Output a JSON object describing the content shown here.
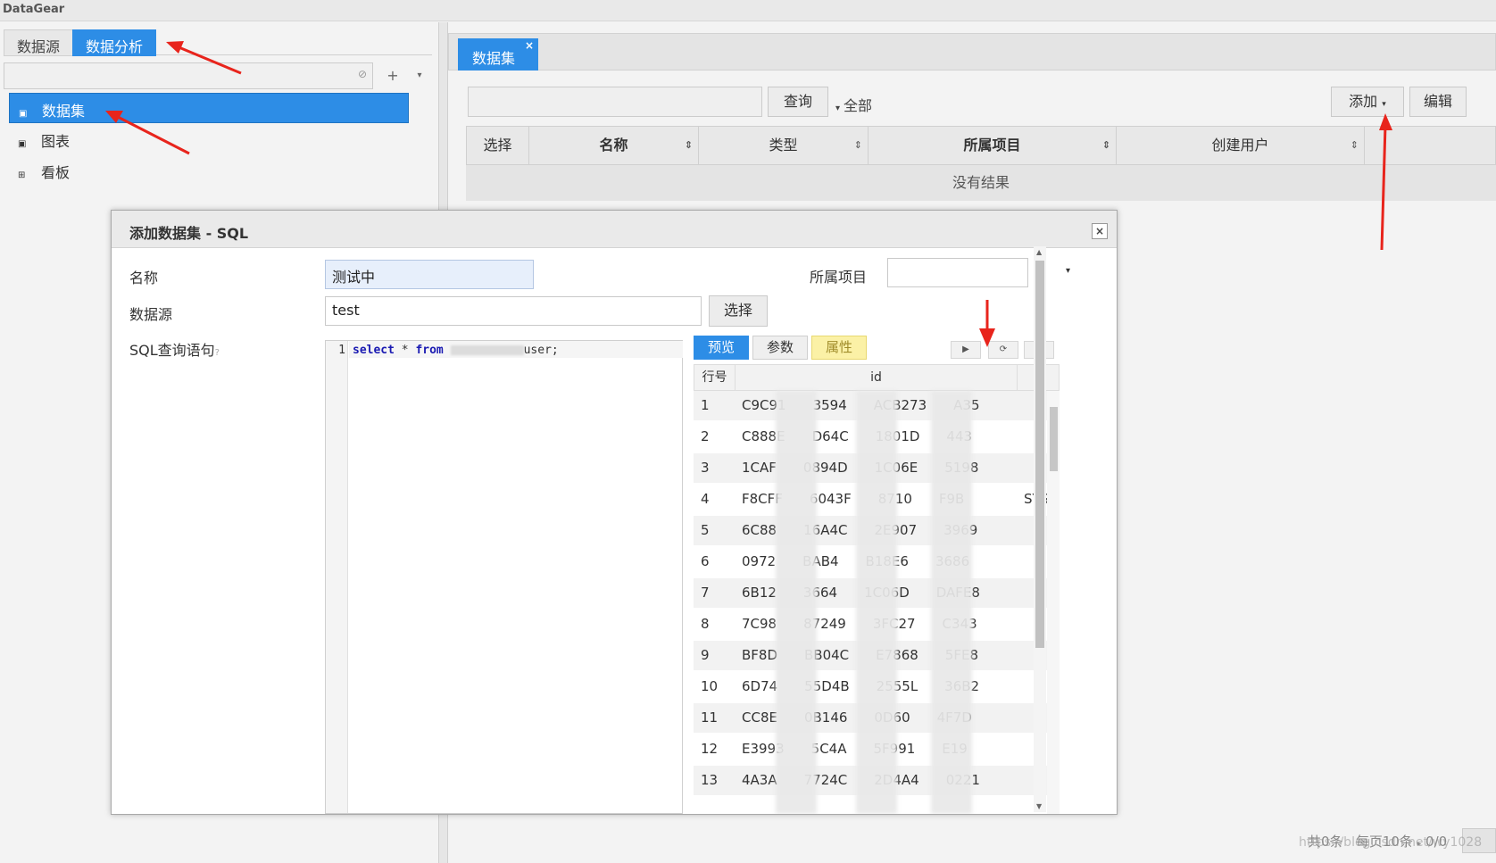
{
  "app": {
    "title": "DataGear"
  },
  "left": {
    "tabs": [
      {
        "label": "数据源",
        "active": false
      },
      {
        "label": "数据分析",
        "active": true
      }
    ],
    "tree": [
      {
        "label": "数据集",
        "icon": "dataset-icon",
        "active": true
      },
      {
        "label": "图表",
        "icon": "chart-icon",
        "active": false
      },
      {
        "label": "看板",
        "icon": "dashboard-icon",
        "active": false
      }
    ],
    "add_button": "+",
    "more_button": "▾"
  },
  "right": {
    "tab": {
      "label": "数据集",
      "close": "×"
    },
    "search_placeholder": "",
    "query_button": "查询",
    "filter_label": "全部",
    "add_button": "添加",
    "edit_button": "编辑",
    "columns": [
      {
        "label": "选择",
        "sortable": false
      },
      {
        "label": "名称",
        "sortable": true
      },
      {
        "label": "类型",
        "sortable": true
      },
      {
        "label": "所属项目",
        "sortable": true
      },
      {
        "label": "创建用户",
        "sortable": true
      }
    ],
    "empty_text": "没有结果",
    "pager": {
      "total": "共0条",
      "per_page": "每页10条",
      "page": "0/0"
    }
  },
  "dialog": {
    "title": "添加数据集 - SQL",
    "close": "×",
    "name_label": "名称",
    "name_value": "测试中",
    "project_label": "所属项目",
    "project_value": "",
    "datasource_label": "数据源",
    "datasource_value": "test",
    "select_button": "选择",
    "sql_label": "SQL查询语句",
    "sql_help": "?",
    "sql": {
      "line": "1",
      "kw1": "select",
      "star": " * ",
      "kw2": "from",
      "table_suffix": "user;"
    },
    "preview_tabs": [
      {
        "label": "预览",
        "state": "active"
      },
      {
        "label": "参数",
        "state": "normal"
      },
      {
        "label": "属性",
        "state": "highlight"
      }
    ],
    "tool_buttons": [
      {
        "icon": "run-icon",
        "glyph": "▶"
      },
      {
        "icon": "refresh-icon",
        "glyph": "⟳"
      },
      {
        "icon": "expand-icon",
        "glyph": "↗"
      }
    ],
    "grid": {
      "head_row": "行号",
      "head_id": "id",
      "rows": [
        {
          "n": "1",
          "id": "C9C91  3594  ACB273  A35",
          "extra": ""
        },
        {
          "n": "2",
          "id": "C888E  D64C  1801D  443",
          "extra": ""
        },
        {
          "n": "3",
          "id": "1CAF  0894D  1C06E  5198",
          "extra": ""
        },
        {
          "n": "4",
          "id": "F8CFF  6043F  8710  F9B",
          "extra": "SYS"
        },
        {
          "n": "5",
          "id": "6C88  16A4C  2E907  3969",
          "extra": ""
        },
        {
          "n": "6",
          "id": "0972  BAB4  B18E6  3686",
          "extra": ""
        },
        {
          "n": "7",
          "id": "6B12  3664  1C06D  DAFE8",
          "extra": ""
        },
        {
          "n": "8",
          "id": "7C98  87249  3FC27  C343",
          "extra": ""
        },
        {
          "n": "9",
          "id": "BF8D  BB04C  E7868  5FE8",
          "extra": ""
        },
        {
          "n": "10",
          "id": "6D74  55D4B  2555L  36B2",
          "extra": ""
        },
        {
          "n": "11",
          "id": "CC8E  0B146  0D60  4F7D",
          "extra": ""
        },
        {
          "n": "12",
          "id": "E3993  5C4A  5F991  E19",
          "extra": ""
        },
        {
          "n": "13",
          "id": "4A3A  7724C  2D4A4  0221",
          "extra": ""
        }
      ]
    }
  },
  "watermark": "https://blog.csdn.net/wy1028",
  "colors": {
    "accent": "#2d8de6",
    "highlight_tab": "#fbf1a6",
    "arrow": "#e8241c"
  }
}
